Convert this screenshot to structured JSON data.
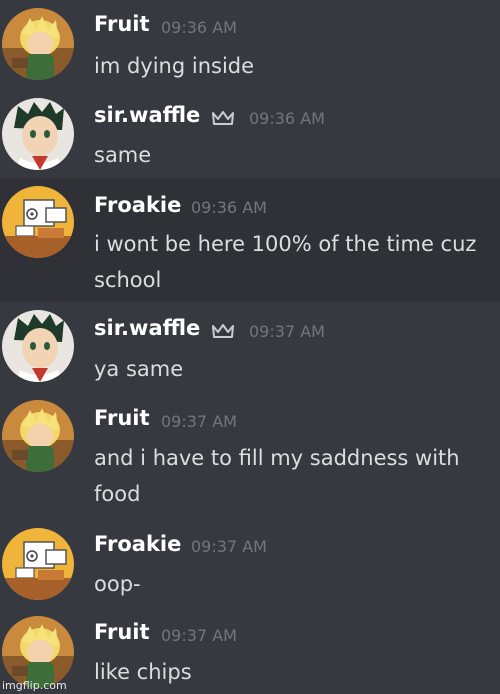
{
  "messages": [
    {
      "user": "Fruit",
      "time": "09:36 AM",
      "lines": [
        "im dying inside"
      ],
      "avatar": "fruit-avatar",
      "owner": false,
      "highlight": false
    },
    {
      "user": "sir.waffle",
      "time": "09:36 AM",
      "lines": [
        "same"
      ],
      "avatar": "waffle-avatar",
      "owner": true,
      "highlight": false
    },
    {
      "user": "Froakie",
      "time": "09:36 AM",
      "lines": [
        "i wont be here 100% of the time cuz",
        "school"
      ],
      "avatar": "froakie-avatar",
      "owner": false,
      "highlight": true
    },
    {
      "user": "sir.waffle",
      "time": "09:37 AM",
      "lines": [
        "ya same"
      ],
      "avatar": "waffle-avatar",
      "owner": true,
      "highlight": false
    },
    {
      "user": "Fruit",
      "time": "09:37 AM",
      "lines": [
        "and i have to fill my saddness with",
        "food"
      ],
      "avatar": "fruit-avatar",
      "owner": false,
      "highlight": false
    },
    {
      "user": "Froakie",
      "time": "09:37 AM",
      "lines": [
        "oop-"
      ],
      "avatar": "froakie-avatar",
      "owner": false,
      "highlight": false
    },
    {
      "user": "Fruit",
      "time": "09:37 AM",
      "lines": [
        "like chips"
      ],
      "avatar": "fruit-avatar",
      "owner": false,
      "highlight": false
    }
  ],
  "watermark": "imgflip.com",
  "colors": {
    "background": "#36393f",
    "highlight_background": "#2f3136",
    "username": "#ffffff",
    "message_text": "#dcddde",
    "timestamp": "#72767d"
  }
}
